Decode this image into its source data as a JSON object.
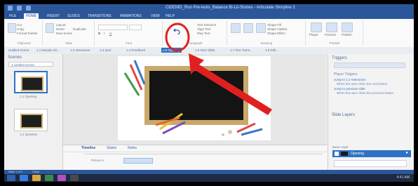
{
  "window": {
    "title": "ClDEMO_Run Pre-tests_Balance Bi-Lit-Stories - Articulate Storyline 2"
  },
  "ribbon_tabs": [
    "FILE",
    "HOME",
    "INSERT",
    "SLIDES",
    "TRANSITIONS",
    "ANIMATIONS",
    "VIEW",
    "HELP"
  ],
  "ribbon": {
    "clipboard_label": "Clipboard",
    "slide_label": "Slide",
    "font_label": "Font",
    "paragraph_label": "Paragraph",
    "drawing_label": "Drawing",
    "publish_label": "Publish",
    "undo_icon": "undo-icon",
    "items_left": [
      "Layout",
      "Reset",
      "New Scene",
      "Duplicate"
    ],
    "items_right": [
      "Text Direction",
      "Align Text",
      "Play Text",
      "Shape Fill",
      "Shape Outline",
      "Shape Effect",
      "Player",
      "Preview",
      "Publish"
    ]
  },
  "slide_tabs": [
    "Untitled Scene",
    "1.1 Results Sli...",
    "1.2 Interaction",
    "1.3 Quiz",
    "1.4 Feedback",
    "1.5 Opening",
    "1.6 Inter-Slide...",
    "1.7 Text Trans...",
    "1.8 Drill..."
  ],
  "scenes_panel": {
    "header": "Scenes",
    "dropdown": "1 Untitled Scene",
    "thumbs": [
      "1.1 Opening",
      "1.2 Question"
    ]
  },
  "timeline": {
    "tabs": [
      "Timeline",
      "States",
      "Notes"
    ],
    "row_label": "Picture 6"
  },
  "triggers_panel": {
    "title": "Triggers",
    "player_triggers_label": "Player Triggers",
    "lines": [
      "Jump to 1.2 Interaction",
      "When the user clicks the next button",
      "Jump to previous slide",
      "When the user clicks the previous button"
    ]
  },
  "layers_panel": {
    "title": "Slide Layers",
    "base_layer": "Opening",
    "base_label": "Base Layer"
  },
  "statusbar": {
    "slide_text": "Slide 1 of 1",
    "clean": "Clean"
  },
  "taskbar": {
    "clock": "4:41 AM"
  },
  "colors": {
    "accent": "#2b579a",
    "selection": "#2f72c4",
    "annotation": "#e02020"
  },
  "annotation": {
    "circle_target": "undo-icon",
    "arrow_direction": "up-left"
  }
}
